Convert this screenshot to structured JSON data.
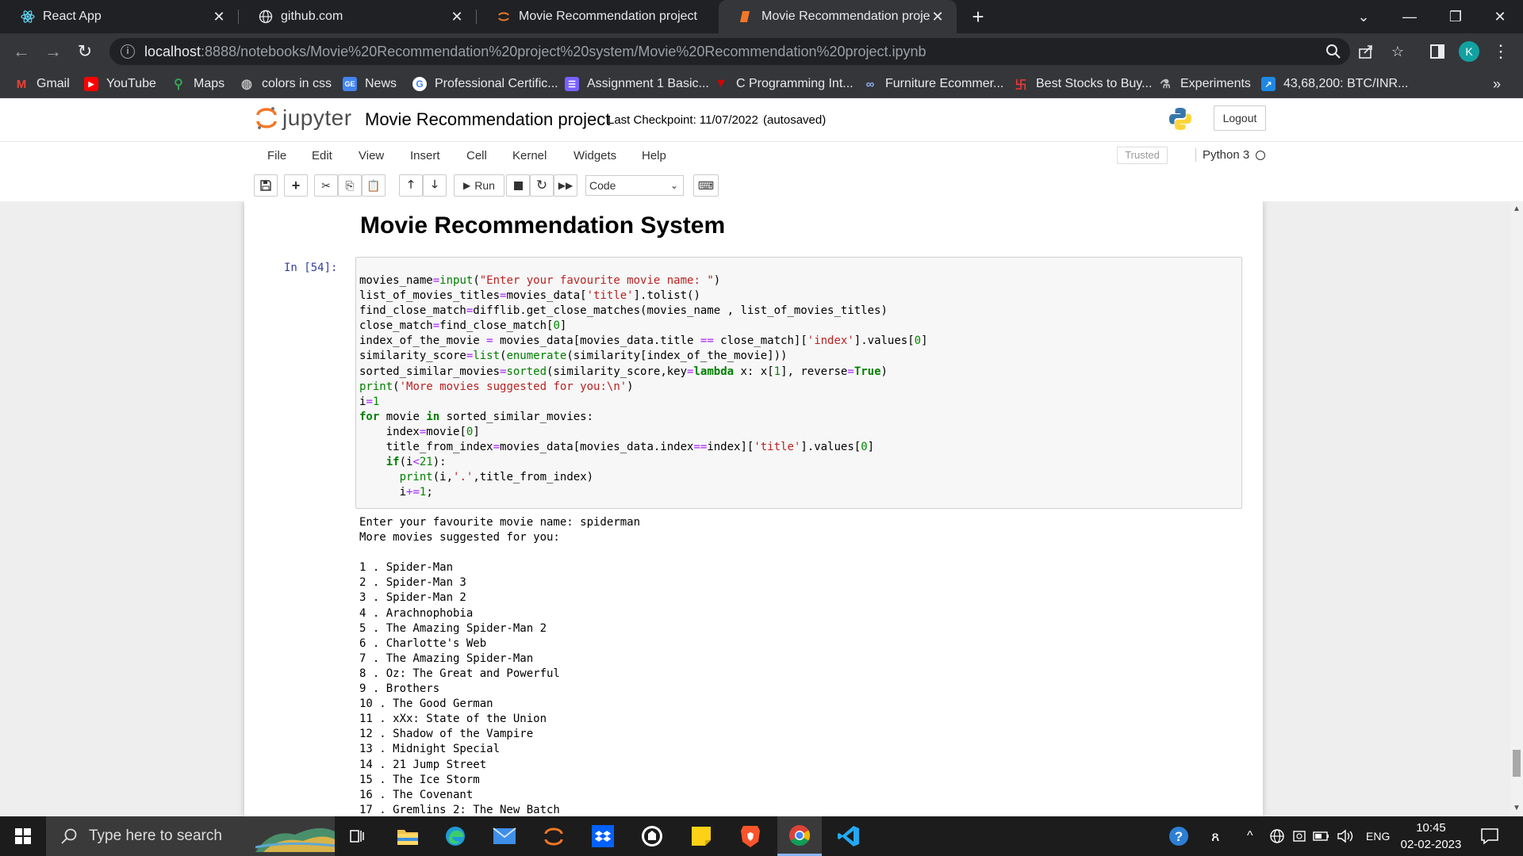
{
  "browser": {
    "tabs": [
      {
        "title": "React App",
        "icon": "react-icon"
      },
      {
        "title": "github.com",
        "icon": "globe-icon"
      },
      {
        "title": "Movie Recommendation project",
        "icon": "jupyter-icon"
      },
      {
        "title": "Movie Recommendation project",
        "icon": "jupyter-icon",
        "active": true
      }
    ],
    "url_host": "localhost",
    "url_path": ":8888/notebooks/Movie%20Recommendation%20project%20system/Movie%20Recommendation%20project.ipynb",
    "profile_initial": "K",
    "bookmarks": [
      {
        "label": "Gmail",
        "icon": "gmail-icon",
        "color": "#ea4335"
      },
      {
        "label": "YouTube",
        "icon": "youtube-icon",
        "color": "#ff0000"
      },
      {
        "label": "Maps",
        "icon": "maps-icon",
        "color": "#34a853"
      },
      {
        "label": "colors in css",
        "icon": "globe-icon",
        "color": "#9aa0a6"
      },
      {
        "label": "News",
        "icon": "news-icon",
        "color": "#4285f4"
      },
      {
        "label": "Professional Certific...",
        "icon": "google-icon",
        "color": "#ffffff"
      },
      {
        "label": "Assignment 1 Basic...",
        "icon": "list-icon",
        "color": "#7b61ff"
      },
      {
        "label": "C Programming Int...",
        "icon": "v-icon",
        "color": "#d50000"
      },
      {
        "label": "Furniture Ecommer...",
        "icon": "link-icon",
        "color": "#8ab4f8"
      },
      {
        "label": "Best Stocks to Buy...",
        "icon": "stocks-icon",
        "color": "#e53935"
      },
      {
        "label": "Experiments",
        "icon": "flask-icon",
        "color": "#bdbdbd"
      },
      {
        "label": "43,68,200: BTC/INR...",
        "icon": "chart-icon",
        "color": "#1e88e5"
      }
    ]
  },
  "jupyter": {
    "logo_text": "jupyter",
    "notebook_title": "Movie Recommendation project",
    "checkpoint": "Last Checkpoint: 11/07/2022",
    "autosaved": "(autosaved)",
    "logout_label": "Logout",
    "menus": [
      "File",
      "Edit",
      "View",
      "Insert",
      "Cell",
      "Kernel",
      "Widgets",
      "Help"
    ],
    "trusted_label": "Trusted",
    "kernel_name": "Python 3",
    "run_label": "Run",
    "cell_type": "Code"
  },
  "notebook": {
    "heading": "Movie Recommendation System",
    "prompt": "In [54]:",
    "code_lines": [
      "movies_name=input(\"Enter your favourite movie name: \")",
      "list_of_movies_titles=movies_data['title'].tolist()",
      "find_close_match=difflib.get_close_matches(movies_name , list_of_movies_titles)",
      "close_match=find_close_match[0]",
      "index_of_the_movie = movies_data[movies_data.title == close_match]['index'].values[0]",
      "similarity_score=list(enumerate(similarity[index_of_the_movie]))",
      "sorted_similar_movies=sorted(similarity_score,key=lambda x: x[1], reverse=True)",
      "print('More movies suggested for you:\\n')",
      "i=1",
      "for movie in sorted_similar_movies:",
      "    index=movie[0]",
      "    title_from_index=movies_data[movies_data.index==index]['title'].values[0]",
      "    if(i<21):",
      "      print(i,'.',title_from_index)",
      "      i+=1;"
    ],
    "output_lines": [
      "Enter your favourite movie name: spiderman",
      "More movies suggested for you:",
      "",
      "1 . Spider-Man",
      "2 . Spider-Man 3",
      "3 . Spider-Man 2",
      "4 . Arachnophobia",
      "5 . The Amazing Spider-Man 2",
      "6 . Charlotte's Web",
      "7 . The Amazing Spider-Man",
      "8 . Oz: The Great and Powerful",
      "9 . Brothers",
      "10 . The Good German",
      "11 . xXx: State of the Union",
      "12 . Shadow of the Vampire",
      "13 . Midnight Special",
      "14 . 21 Jump Street",
      "15 . The Ice Storm",
      "16 . The Covenant",
      "17 . Gremlins 2: The New Batch"
    ]
  },
  "taskbar": {
    "search_placeholder": "Type here to search",
    "language": "ENG",
    "time": "10:45",
    "date": "02-02-2023"
  }
}
